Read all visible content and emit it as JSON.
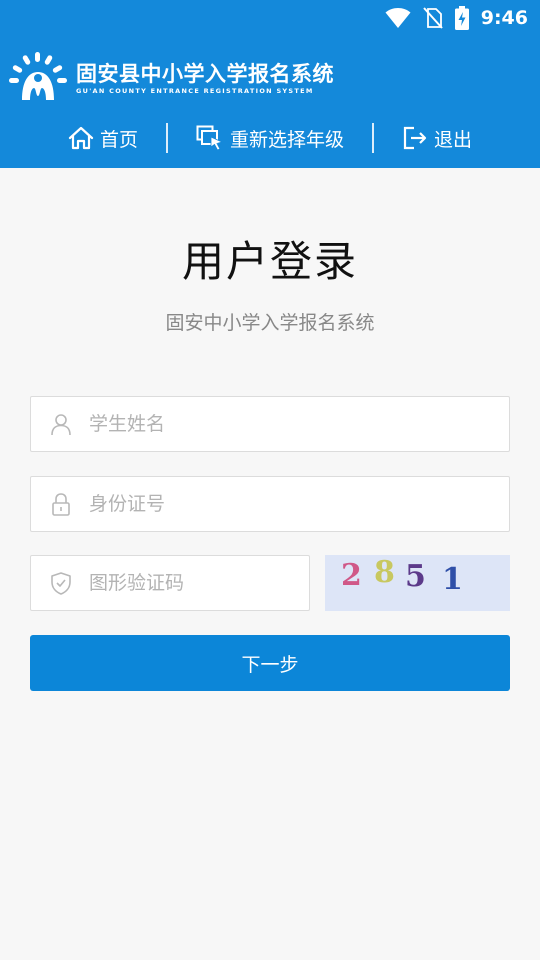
{
  "status_bar": {
    "time": "9:46"
  },
  "header": {
    "title": "固安县中小学入学报名系统",
    "subtitle": "GU'AN COUNTY ENTRANCE REGISTRATION SYSTEM",
    "nav": [
      {
        "label": "首页",
        "icon": "home-icon"
      },
      {
        "label": "重新选择年级",
        "icon": "windows-cursor-icon"
      },
      {
        "label": "退出",
        "icon": "logout-icon"
      }
    ]
  },
  "login": {
    "title": "用户登录",
    "subtitle": "固安中小学入学报名系统",
    "student_name": {
      "value": "",
      "placeholder": "学生姓名",
      "icon": "user-icon"
    },
    "id_number": {
      "value": "",
      "placeholder": "身份证号",
      "icon": "lock-icon"
    },
    "captcha": {
      "value": "",
      "placeholder": "图形验证码",
      "icon": "shield-check-icon",
      "code": "2851"
    },
    "next_label": "下一步"
  },
  "colors": {
    "primary": "#1489da",
    "button": "#0c86d8",
    "background": "#f7f7f7"
  }
}
